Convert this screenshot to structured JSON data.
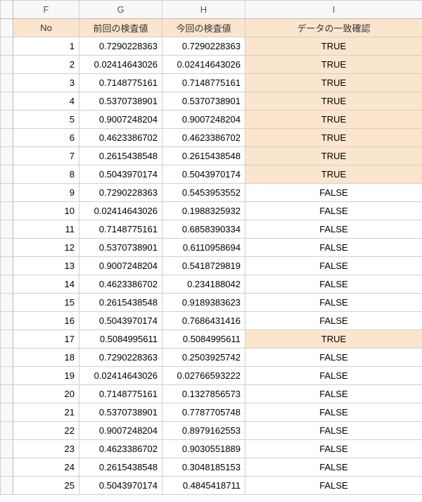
{
  "columns": {
    "F": "F",
    "G": "G",
    "H": "H",
    "I": "I"
  },
  "headers": {
    "no": "No",
    "prev": "前回の検査値",
    "curr": "今回の検査値",
    "match": "データの一致確認"
  },
  "rows": [
    {
      "no": "1",
      "prev": "0.7290228363",
      "curr": "0.7290228363",
      "match": "TRUE"
    },
    {
      "no": "2",
      "prev": "0.02414643026",
      "curr": "0.02414643026",
      "match": "TRUE"
    },
    {
      "no": "3",
      "prev": "0.7148775161",
      "curr": "0.7148775161",
      "match": "TRUE"
    },
    {
      "no": "4",
      "prev": "0.5370738901",
      "curr": "0.5370738901",
      "match": "TRUE"
    },
    {
      "no": "5",
      "prev": "0.9007248204",
      "curr": "0.9007248204",
      "match": "TRUE"
    },
    {
      "no": "6",
      "prev": "0.4623386702",
      "curr": "0.4623386702",
      "match": "TRUE"
    },
    {
      "no": "7",
      "prev": "0.2615438548",
      "curr": "0.2615438548",
      "match": "TRUE"
    },
    {
      "no": "8",
      "prev": "0.5043970174",
      "curr": "0.5043970174",
      "match": "TRUE"
    },
    {
      "no": "9",
      "prev": "0.7290228363",
      "curr": "0.5453953552",
      "match": "FALSE"
    },
    {
      "no": "10",
      "prev": "0.02414643026",
      "curr": "0.1988325932",
      "match": "FALSE"
    },
    {
      "no": "11",
      "prev": "0.7148775161",
      "curr": "0.6858390334",
      "match": "FALSE"
    },
    {
      "no": "12",
      "prev": "0.5370738901",
      "curr": "0.6110958694",
      "match": "FALSE"
    },
    {
      "no": "13",
      "prev": "0.9007248204",
      "curr": "0.5418729819",
      "match": "FALSE"
    },
    {
      "no": "14",
      "prev": "0.4623386702",
      "curr": "0.234188042",
      "match": "FALSE"
    },
    {
      "no": "15",
      "prev": "0.2615438548",
      "curr": "0.9189383623",
      "match": "FALSE"
    },
    {
      "no": "16",
      "prev": "0.5043970174",
      "curr": "0.7686431416",
      "match": "FALSE"
    },
    {
      "no": "17",
      "prev": "0.5084995611",
      "curr": "0.5084995611",
      "match": "TRUE"
    },
    {
      "no": "18",
      "prev": "0.7290228363",
      "curr": "0.2503925742",
      "match": "FALSE"
    },
    {
      "no": "19",
      "prev": "0.02414643026",
      "curr": "0.02766593222",
      "match": "FALSE"
    },
    {
      "no": "20",
      "prev": "0.7148775161",
      "curr": "0.1327856573",
      "match": "FALSE"
    },
    {
      "no": "21",
      "prev": "0.5370738901",
      "curr": "0.7787705748",
      "match": "FALSE"
    },
    {
      "no": "22",
      "prev": "0.9007248204",
      "curr": "0.8979162553",
      "match": "FALSE"
    },
    {
      "no": "23",
      "prev": "0.4623386702",
      "curr": "0.9030551889",
      "match": "FALSE"
    },
    {
      "no": "24",
      "prev": "0.2615438548",
      "curr": "0.3048185153",
      "match": "FALSE"
    },
    {
      "no": "25",
      "prev": "0.5043970174",
      "curr": "0.4845418711",
      "match": "FALSE"
    }
  ]
}
